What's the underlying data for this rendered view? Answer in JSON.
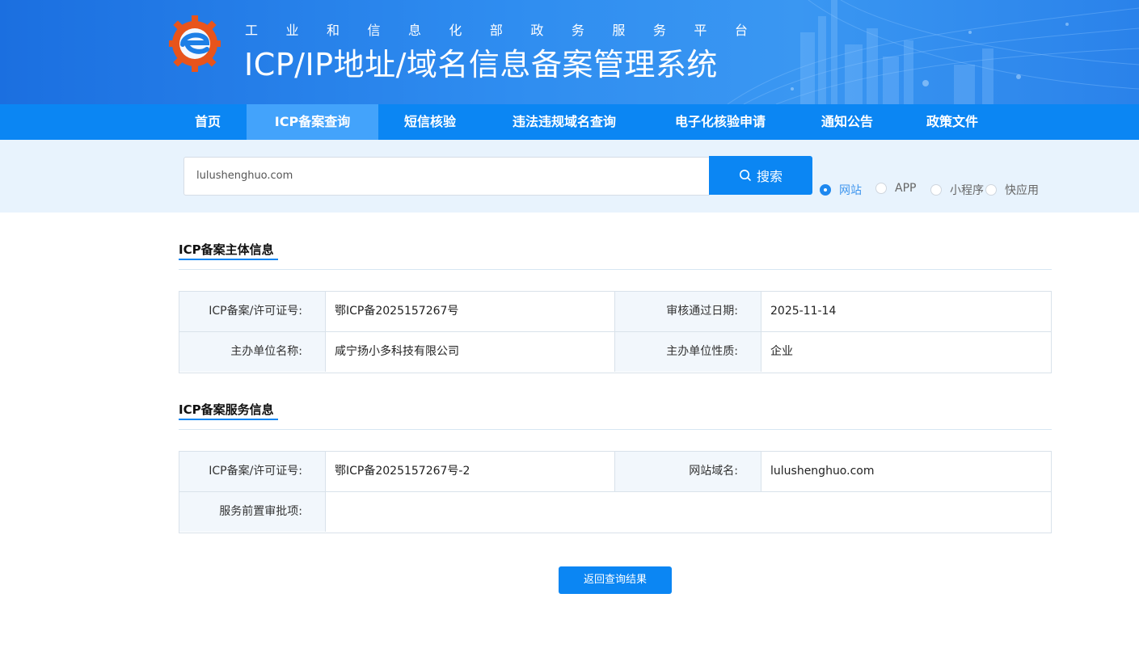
{
  "header": {
    "subtitle_chars": [
      "工",
      "业",
      "和",
      "信",
      "息",
      "化",
      "部",
      "政",
      "务",
      "服",
      "务",
      "平",
      "台"
    ],
    "title": "ICP/IP地址/域名信息备案管理系统",
    "logo_icon": "gear-e-logo-icon"
  },
  "nav": {
    "items": [
      {
        "label": "首页"
      },
      {
        "label": "ICP备案查询",
        "active": true
      },
      {
        "label": "短信核验"
      },
      {
        "label": "违法违规域名查询"
      },
      {
        "label": "电子化核验申请"
      },
      {
        "label": "通知公告"
      },
      {
        "label": "政策文件"
      }
    ]
  },
  "search": {
    "value": "lulushenghuo.com",
    "button_label": "搜索",
    "button_icon": "search-icon",
    "types": [
      {
        "label": "网站",
        "checked": true
      },
      {
        "label": "APP",
        "checked": false
      },
      {
        "label": "小程序",
        "checked": false
      },
      {
        "label": "快应用",
        "checked": false
      }
    ]
  },
  "subject": {
    "title": "ICP备案主体信息",
    "license_label": "ICP备案/许可证号:",
    "license_value": "鄂ICP备2025157267号",
    "approve_date_label": "审核通过日期:",
    "approve_date_value": "2025-11-14",
    "org_name_label": "主办单位名称:",
    "org_name_value": "咸宁扬小多科技有限公司",
    "org_type_label": "主办单位性质:",
    "org_type_value": "企业"
  },
  "service": {
    "title": "ICP备案服务信息",
    "license_label": "ICP备案/许可证号:",
    "license_value": "鄂ICP备2025157267号-2",
    "domain_label": "网站域名:",
    "domain_value": "lulushenghuo.com",
    "preapproval_label": "服务前置审批项:",
    "preapproval_value": ""
  },
  "back_button": "返回查询结果",
  "colors": {
    "primary": "#0b86f3",
    "nav_active": "#43a3fb",
    "search_band": "#e8f3fd",
    "label_bg": "#f2f7fc"
  }
}
